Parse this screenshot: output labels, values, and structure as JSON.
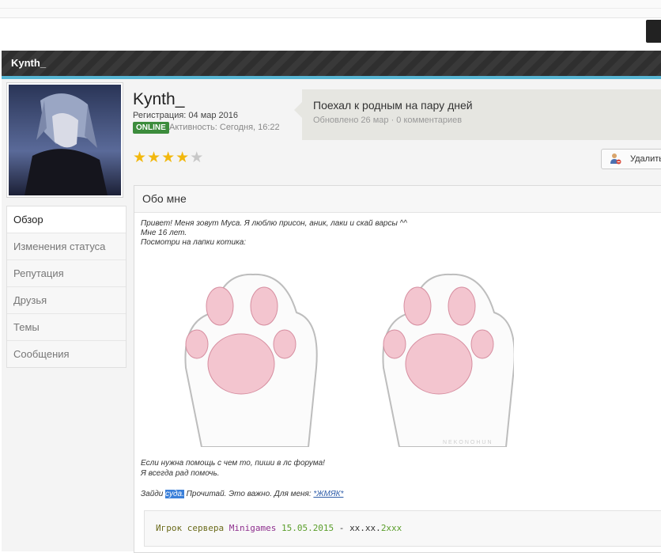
{
  "profile": {
    "header_name": "Kynth_",
    "username": "Kynth_",
    "registration": "Регистрация: 04 мар 2016",
    "online_badge": "ONLINE",
    "activity": "Активность: Сегодня, 16:22",
    "rating": 4,
    "rating_max": 5
  },
  "status": {
    "text": "Поехал к родным на пару дней",
    "meta": "Обновлено 26 мар · 0 комментариев"
  },
  "actions": {
    "delete_label": "Удалить"
  },
  "tabs": [
    {
      "label": "Обзор",
      "active": true
    },
    {
      "label": "Изменения статуса",
      "active": false
    },
    {
      "label": "Репутация",
      "active": false
    },
    {
      "label": "Друзья",
      "active": false
    },
    {
      "label": "Темы",
      "active": false
    },
    {
      "label": "Сообщения",
      "active": false
    }
  ],
  "about": {
    "title": "Обо мне",
    "line1": "Привет! Меня зовут Муса. Я люблю присон, аник, лаки и скай варсы ^^",
    "line2": "Мне 16 лет.",
    "line3": "Посмотри на лапки котика:",
    "help1": "Если нужна помощь с чем то, пиши в лс форума!",
    "help2": "Я всегда рад помочь.",
    "visit_prefix": "Зайди ",
    "visit_link": "суда.",
    "visit_mid": " Прочитай. Это важно. Для меня: ",
    "visit_link2": "*ЖМЯК*",
    "paw_watermark": "NEKONOHUN"
  },
  "code": {
    "p1": "Игрок сервера ",
    "p2": "Minigames",
    "p3": " ",
    "p4": "15.05.2015",
    "p5": " - ",
    "p6": "xx.xx.",
    "p7": "2xxx"
  },
  "colors": {
    "accent_bar": "#56b5d3",
    "online_green": "#3c8c3c",
    "star_gold": "#f2b80e",
    "link_blue": "#2e5ca8"
  }
}
